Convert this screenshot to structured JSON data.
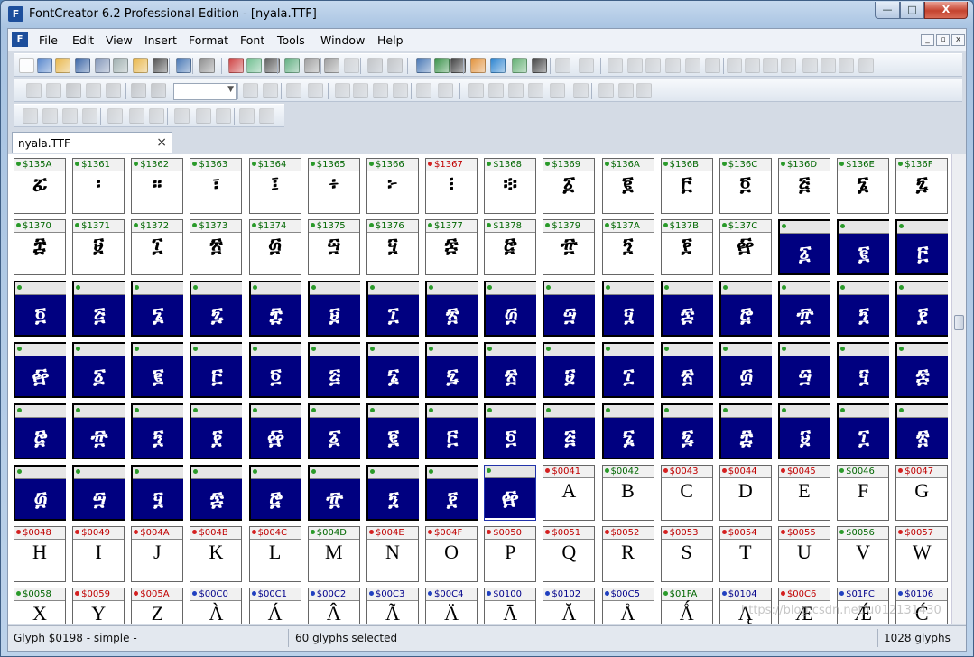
{
  "window": {
    "title": "FontCreator 6.2 Professional Edition - [nyala.TTF]",
    "icon_label": "F",
    "minimize": "—",
    "maximize": "□",
    "close": "X"
  },
  "menu": {
    "icon_label": "F",
    "items": [
      "File",
      "Edit",
      "View",
      "Insert",
      "Format",
      "Font",
      "Tools",
      "Window",
      "Help"
    ],
    "mdi_minimize": "_",
    "mdi_restore": "▫",
    "mdi_close": "x"
  },
  "tab": {
    "label": "nyala.TTF",
    "close": "×"
  },
  "colors": {
    "selection": "#000080",
    "green": "#006600",
    "red": "#c00000",
    "blue": "#00008b"
  },
  "glyph_rows": [
    [
      {
        "code": "$135A",
        "glyph": "ፚ",
        "color": "green"
      },
      {
        "code": "$1361",
        "glyph": "፡",
        "color": "green"
      },
      {
        "code": "$1362",
        "glyph": "።",
        "color": "green"
      },
      {
        "code": "$1363",
        "glyph": "፣",
        "color": "green"
      },
      {
        "code": "$1364",
        "glyph": "፤",
        "color": "green"
      },
      {
        "code": "$1365",
        "glyph": "፥",
        "color": "green"
      },
      {
        "code": "$1366",
        "glyph": "፦",
        "color": "green"
      },
      {
        "code": "$1367",
        "glyph": "፧",
        "color": "red"
      },
      {
        "code": "$1368",
        "glyph": "፨",
        "color": "green"
      },
      {
        "code": "$1369",
        "glyph": "፩",
        "color": "green"
      },
      {
        "code": "$136A",
        "glyph": "፪",
        "color": "green"
      },
      {
        "code": "$136B",
        "glyph": "፫",
        "color": "green"
      },
      {
        "code": "$136C",
        "glyph": "፬",
        "color": "green"
      },
      {
        "code": "$136D",
        "glyph": "፭",
        "color": "green"
      },
      {
        "code": "$136E",
        "glyph": "፮",
        "color": "green"
      },
      {
        "code": "$136F",
        "glyph": "፯",
        "color": "green"
      }
    ],
    [
      {
        "code": "$1370",
        "glyph": "፰",
        "color": "green"
      },
      {
        "code": "$1371",
        "glyph": "፱",
        "color": "green"
      },
      {
        "code": "$1372",
        "glyph": "፲",
        "color": "green"
      },
      {
        "code": "$1373",
        "glyph": "፳",
        "color": "green"
      },
      {
        "code": "$1374",
        "glyph": "፴",
        "color": "green"
      },
      {
        "code": "$1375",
        "glyph": "፵",
        "color": "green"
      },
      {
        "code": "$1376",
        "glyph": "፶",
        "color": "green"
      },
      {
        "code": "$1377",
        "glyph": "፷",
        "color": "green"
      },
      {
        "code": "$1378",
        "glyph": "፸",
        "color": "green"
      },
      {
        "code": "$1379",
        "glyph": "፹",
        "color": "green"
      },
      {
        "code": "$137A",
        "glyph": "፺",
        "color": "green"
      },
      {
        "code": "$137B",
        "glyph": "፻",
        "color": "green"
      },
      {
        "code": "$137C",
        "glyph": "፼",
        "color": "green"
      },
      {
        "code": "",
        "glyph": "፩",
        "color": "green",
        "selected": true
      },
      {
        "code": "",
        "glyph": "፪",
        "color": "green",
        "selected": true
      },
      {
        "code": "",
        "glyph": "፫",
        "color": "green",
        "selected": true
      }
    ],
    [
      {
        "code": "",
        "glyph": "፬",
        "color": "green",
        "selected": true
      },
      {
        "code": "",
        "glyph": "፭",
        "color": "green",
        "selected": true
      },
      {
        "code": "",
        "glyph": "፮",
        "color": "green",
        "selected": true
      },
      {
        "code": "",
        "glyph": "፯",
        "color": "green",
        "selected": true
      },
      {
        "code": "",
        "glyph": "፰",
        "color": "green",
        "selected": true
      },
      {
        "code": "",
        "glyph": "፱",
        "color": "green",
        "selected": true
      },
      {
        "code": "",
        "glyph": "፲",
        "color": "green",
        "selected": true
      },
      {
        "code": "",
        "glyph": "፳",
        "color": "green",
        "selected": true
      },
      {
        "code": "",
        "glyph": "፴",
        "color": "green",
        "selected": true
      },
      {
        "code": "",
        "glyph": "፵",
        "color": "green",
        "selected": true
      },
      {
        "code": "",
        "glyph": "፶",
        "color": "green",
        "selected": true
      },
      {
        "code": "",
        "glyph": "፷",
        "color": "green",
        "selected": true
      },
      {
        "code": "",
        "glyph": "፸",
        "color": "green",
        "selected": true
      },
      {
        "code": "",
        "glyph": "፹",
        "color": "green",
        "selected": true
      },
      {
        "code": "",
        "glyph": "፺",
        "color": "green",
        "selected": true
      },
      {
        "code": "",
        "glyph": "፻",
        "color": "green",
        "selected": true
      }
    ],
    [
      {
        "code": "",
        "glyph": "፼",
        "color": "green",
        "selected": true
      },
      {
        "code": "",
        "glyph": "፩",
        "color": "green",
        "selected": true
      },
      {
        "code": "",
        "glyph": "፪",
        "color": "green",
        "selected": true
      },
      {
        "code": "",
        "glyph": "፫",
        "color": "green",
        "selected": true
      },
      {
        "code": "",
        "glyph": "፬",
        "color": "green",
        "selected": true
      },
      {
        "code": "",
        "glyph": "፭",
        "color": "green",
        "selected": true
      },
      {
        "code": "",
        "glyph": "፮",
        "color": "green",
        "selected": true
      },
      {
        "code": "",
        "glyph": "፯",
        "color": "green",
        "selected": true
      },
      {
        "code": "",
        "glyph": "፳",
        "color": "green",
        "selected": true
      },
      {
        "code": "",
        "glyph": "፱",
        "color": "green",
        "selected": true
      },
      {
        "code": "",
        "glyph": "፲",
        "color": "green",
        "selected": true
      },
      {
        "code": "",
        "glyph": "፳",
        "color": "green",
        "selected": true
      },
      {
        "code": "",
        "glyph": "፴",
        "color": "green",
        "selected": true
      },
      {
        "code": "",
        "glyph": "፵",
        "color": "green",
        "selected": true
      },
      {
        "code": "",
        "glyph": "፶",
        "color": "green",
        "selected": true
      },
      {
        "code": "",
        "glyph": "፷",
        "color": "green",
        "selected": true
      }
    ],
    [
      {
        "code": "",
        "glyph": "፸",
        "color": "green",
        "selected": true
      },
      {
        "code": "",
        "glyph": "፹",
        "color": "green",
        "selected": true
      },
      {
        "code": "",
        "glyph": "፺",
        "color": "green",
        "selected": true
      },
      {
        "code": "",
        "glyph": "፻",
        "color": "green",
        "selected": true
      },
      {
        "code": "",
        "glyph": "፼",
        "color": "green",
        "selected": true
      },
      {
        "code": "",
        "glyph": "፩",
        "color": "green",
        "selected": true
      },
      {
        "code": "",
        "glyph": "፪",
        "color": "green",
        "selected": true
      },
      {
        "code": "",
        "glyph": "፫",
        "color": "green",
        "selected": true
      },
      {
        "code": "",
        "glyph": "፬",
        "color": "green",
        "selected": true
      },
      {
        "code": "",
        "glyph": "፭",
        "color": "green",
        "selected": true
      },
      {
        "code": "",
        "glyph": "፮",
        "color": "green",
        "selected": true
      },
      {
        "code": "",
        "glyph": "፯",
        "color": "green",
        "selected": true
      },
      {
        "code": "",
        "glyph": "፰",
        "color": "green",
        "selected": true
      },
      {
        "code": "",
        "glyph": "፱",
        "color": "green",
        "selected": true
      },
      {
        "code": "",
        "glyph": "፲",
        "color": "green",
        "selected": true
      },
      {
        "code": "",
        "glyph": "፳",
        "color": "green",
        "selected": true
      }
    ],
    [
      {
        "code": "",
        "glyph": "፴",
        "color": "green",
        "selected": true
      },
      {
        "code": "",
        "glyph": "፵",
        "color": "green",
        "selected": true
      },
      {
        "code": "",
        "glyph": "፶",
        "color": "green",
        "selected": true
      },
      {
        "code": "",
        "glyph": "፷",
        "color": "green",
        "selected": true
      },
      {
        "code": "",
        "glyph": "፸",
        "color": "green",
        "selected": true
      },
      {
        "code": "",
        "glyph": "፹",
        "color": "green",
        "selected": true
      },
      {
        "code": "",
        "glyph": "፺",
        "color": "green",
        "selected": true
      },
      {
        "code": "",
        "glyph": "፻",
        "color": "green",
        "selected": true
      },
      {
        "code": "",
        "glyph": "፼",
        "color": "green",
        "selected": true,
        "focus": true
      },
      {
        "code": "$0041",
        "glyph": "A",
        "color": "red"
      },
      {
        "code": "$0042",
        "glyph": "B",
        "color": "green"
      },
      {
        "code": "$0043",
        "glyph": "C",
        "color": "red"
      },
      {
        "code": "$0044",
        "glyph": "D",
        "color": "red"
      },
      {
        "code": "$0045",
        "glyph": "E",
        "color": "red"
      },
      {
        "code": "$0046",
        "glyph": "F",
        "color": "green"
      },
      {
        "code": "$0047",
        "glyph": "G",
        "color": "red"
      }
    ],
    [
      {
        "code": "$0048",
        "glyph": "H",
        "color": "red"
      },
      {
        "code": "$0049",
        "glyph": "I",
        "color": "red"
      },
      {
        "code": "$004A",
        "glyph": "J",
        "color": "red"
      },
      {
        "code": "$004B",
        "glyph": "K",
        "color": "red"
      },
      {
        "code": "$004C",
        "glyph": "L",
        "color": "red"
      },
      {
        "code": "$004D",
        "glyph": "M",
        "color": "green"
      },
      {
        "code": "$004E",
        "glyph": "N",
        "color": "red"
      },
      {
        "code": "$004F",
        "glyph": "O",
        "color": "red"
      },
      {
        "code": "$0050",
        "glyph": "P",
        "color": "red"
      },
      {
        "code": "$0051",
        "glyph": "Q",
        "color": "red"
      },
      {
        "code": "$0052",
        "glyph": "R",
        "color": "red"
      },
      {
        "code": "$0053",
        "glyph": "S",
        "color": "red"
      },
      {
        "code": "$0054",
        "glyph": "T",
        "color": "red"
      },
      {
        "code": "$0055",
        "glyph": "U",
        "color": "red"
      },
      {
        "code": "$0056",
        "glyph": "V",
        "color": "green"
      },
      {
        "code": "$0057",
        "glyph": "W",
        "color": "red"
      }
    ],
    [
      {
        "code": "$0058",
        "glyph": "X",
        "color": "green"
      },
      {
        "code": "$0059",
        "glyph": "Y",
        "color": "red"
      },
      {
        "code": "$005A",
        "glyph": "Z",
        "color": "red"
      },
      {
        "code": "$00C0",
        "glyph": "À",
        "color": "blue"
      },
      {
        "code": "$00C1",
        "glyph": "Á",
        "color": "blue"
      },
      {
        "code": "$00C2",
        "glyph": "Â",
        "color": "blue"
      },
      {
        "code": "$00C3",
        "glyph": "Ã",
        "color": "blue"
      },
      {
        "code": "$00C4",
        "glyph": "Ä",
        "color": "blue"
      },
      {
        "code": "$0100",
        "glyph": "Ā",
        "color": "blue"
      },
      {
        "code": "$0102",
        "glyph": "Ă",
        "color": "blue"
      },
      {
        "code": "$00C5",
        "glyph": "Å",
        "color": "blue"
      },
      {
        "code": "$01FA",
        "glyph": "Ǻ",
        "color": "green"
      },
      {
        "code": "$0104",
        "glyph": "Ą",
        "color": "blue"
      },
      {
        "code": "$00C6",
        "glyph": "Æ",
        "color": "red"
      },
      {
        "code": "$01FC",
        "glyph": "Ǽ",
        "color": "blue"
      },
      {
        "code": "$0106",
        "glyph": "Ć",
        "color": "blue"
      }
    ]
  ],
  "status": {
    "glyph_info": "Glyph $0198 - simple -",
    "selection": "60 glyphs selected",
    "total": "1028 glyphs",
    "watermark": "https://blog.csdn.net/u012131430"
  }
}
